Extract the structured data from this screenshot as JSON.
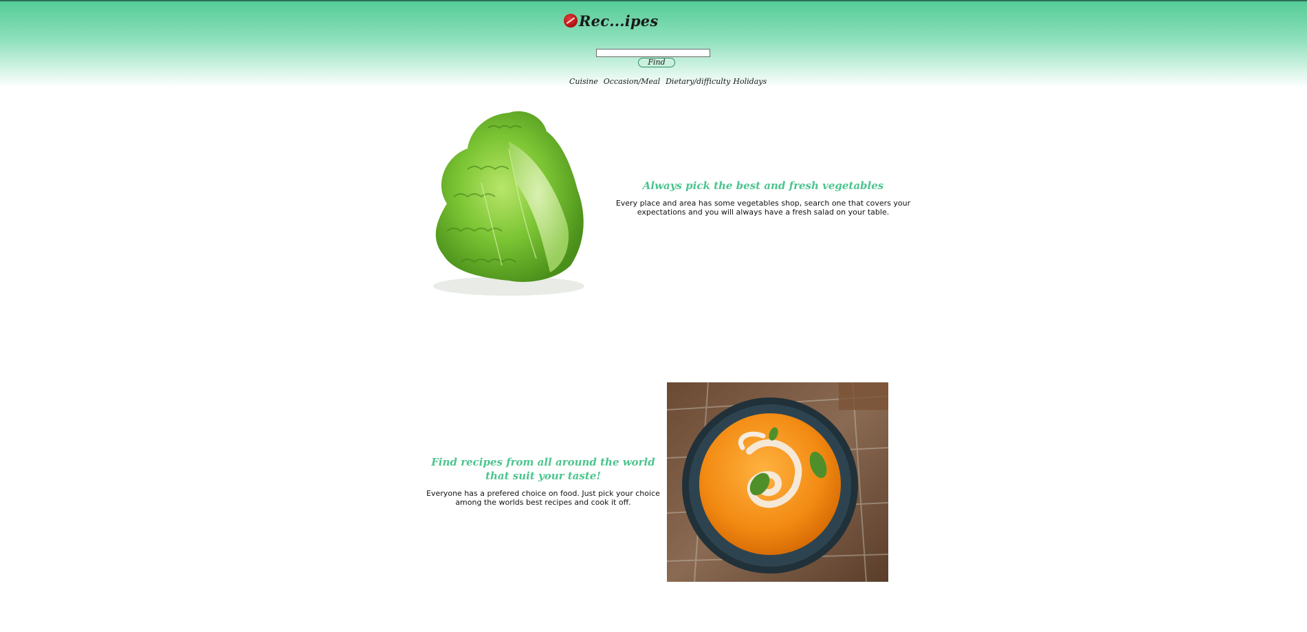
{
  "header": {
    "logo_text": "Rec...ipes",
    "logo_icon": "tomato-logo-icon",
    "search_placeholder": "",
    "search_value": "",
    "find_label": "Find",
    "nav": [
      "Cuisine",
      "Occasion/Meal",
      "Dietary/difficulty",
      "Holidays"
    ],
    "colors": {
      "gradient_top": "#55cc97",
      "accent": "#4cc48e"
    }
  },
  "sections": [
    {
      "image": "lettuce-image",
      "title": "Always pick the best and fresh vegetables",
      "text": "Every place and area has some vegetables shop, search one that covers your expectations and you will always have a fresh salad on your table."
    },
    {
      "image": "soup-image",
      "title": "Find recipes from all around the world that suit your taste!",
      "text": "Everyone has a prefered choice on food. Just pick your choice among the worlds best recipes and cook it off."
    }
  ]
}
